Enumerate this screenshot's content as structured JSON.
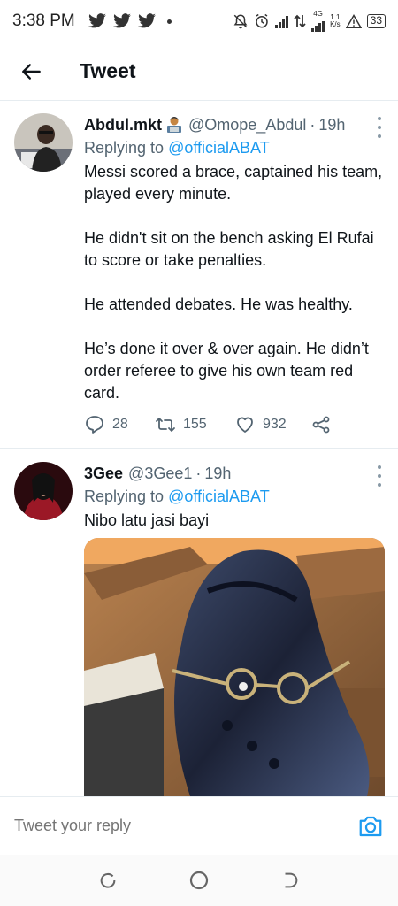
{
  "status_bar": {
    "time": "3:38 PM",
    "network": "4G",
    "speed_value": "1.1",
    "speed_unit": "K/s",
    "battery": "33"
  },
  "header": {
    "title": "Tweet"
  },
  "tweets": [
    {
      "name": "Abdul.mkt",
      "handle": "@Omope_Abdul",
      "separator": "·",
      "time": "19h",
      "replying_prefix": "Replying to",
      "replying_to": "@officialABAT",
      "text": "Messi scored a brace, captained his team, played every minute.\n\nHe didn't sit on the bench asking El Rufai to score or take penalties.\n\nHe attended debates. He was healthy.\n\nHe’s done it over & over again. He didn’t order referee to give his own team red card.",
      "replies": "28",
      "retweets": "155",
      "likes": "932"
    },
    {
      "name": "3Gee",
      "handle": "@3Gee1",
      "separator": "·",
      "time": "19h",
      "replying_prefix": "Replying to",
      "replying_to": "@officialABAT",
      "text": "Nibo latu jasi bayi"
    }
  ],
  "reply_bar": {
    "placeholder": "Tweet your reply"
  },
  "colors": {
    "accent": "#1d9bf0",
    "secondary_text": "#536471",
    "divider": "#e6ecf0"
  }
}
